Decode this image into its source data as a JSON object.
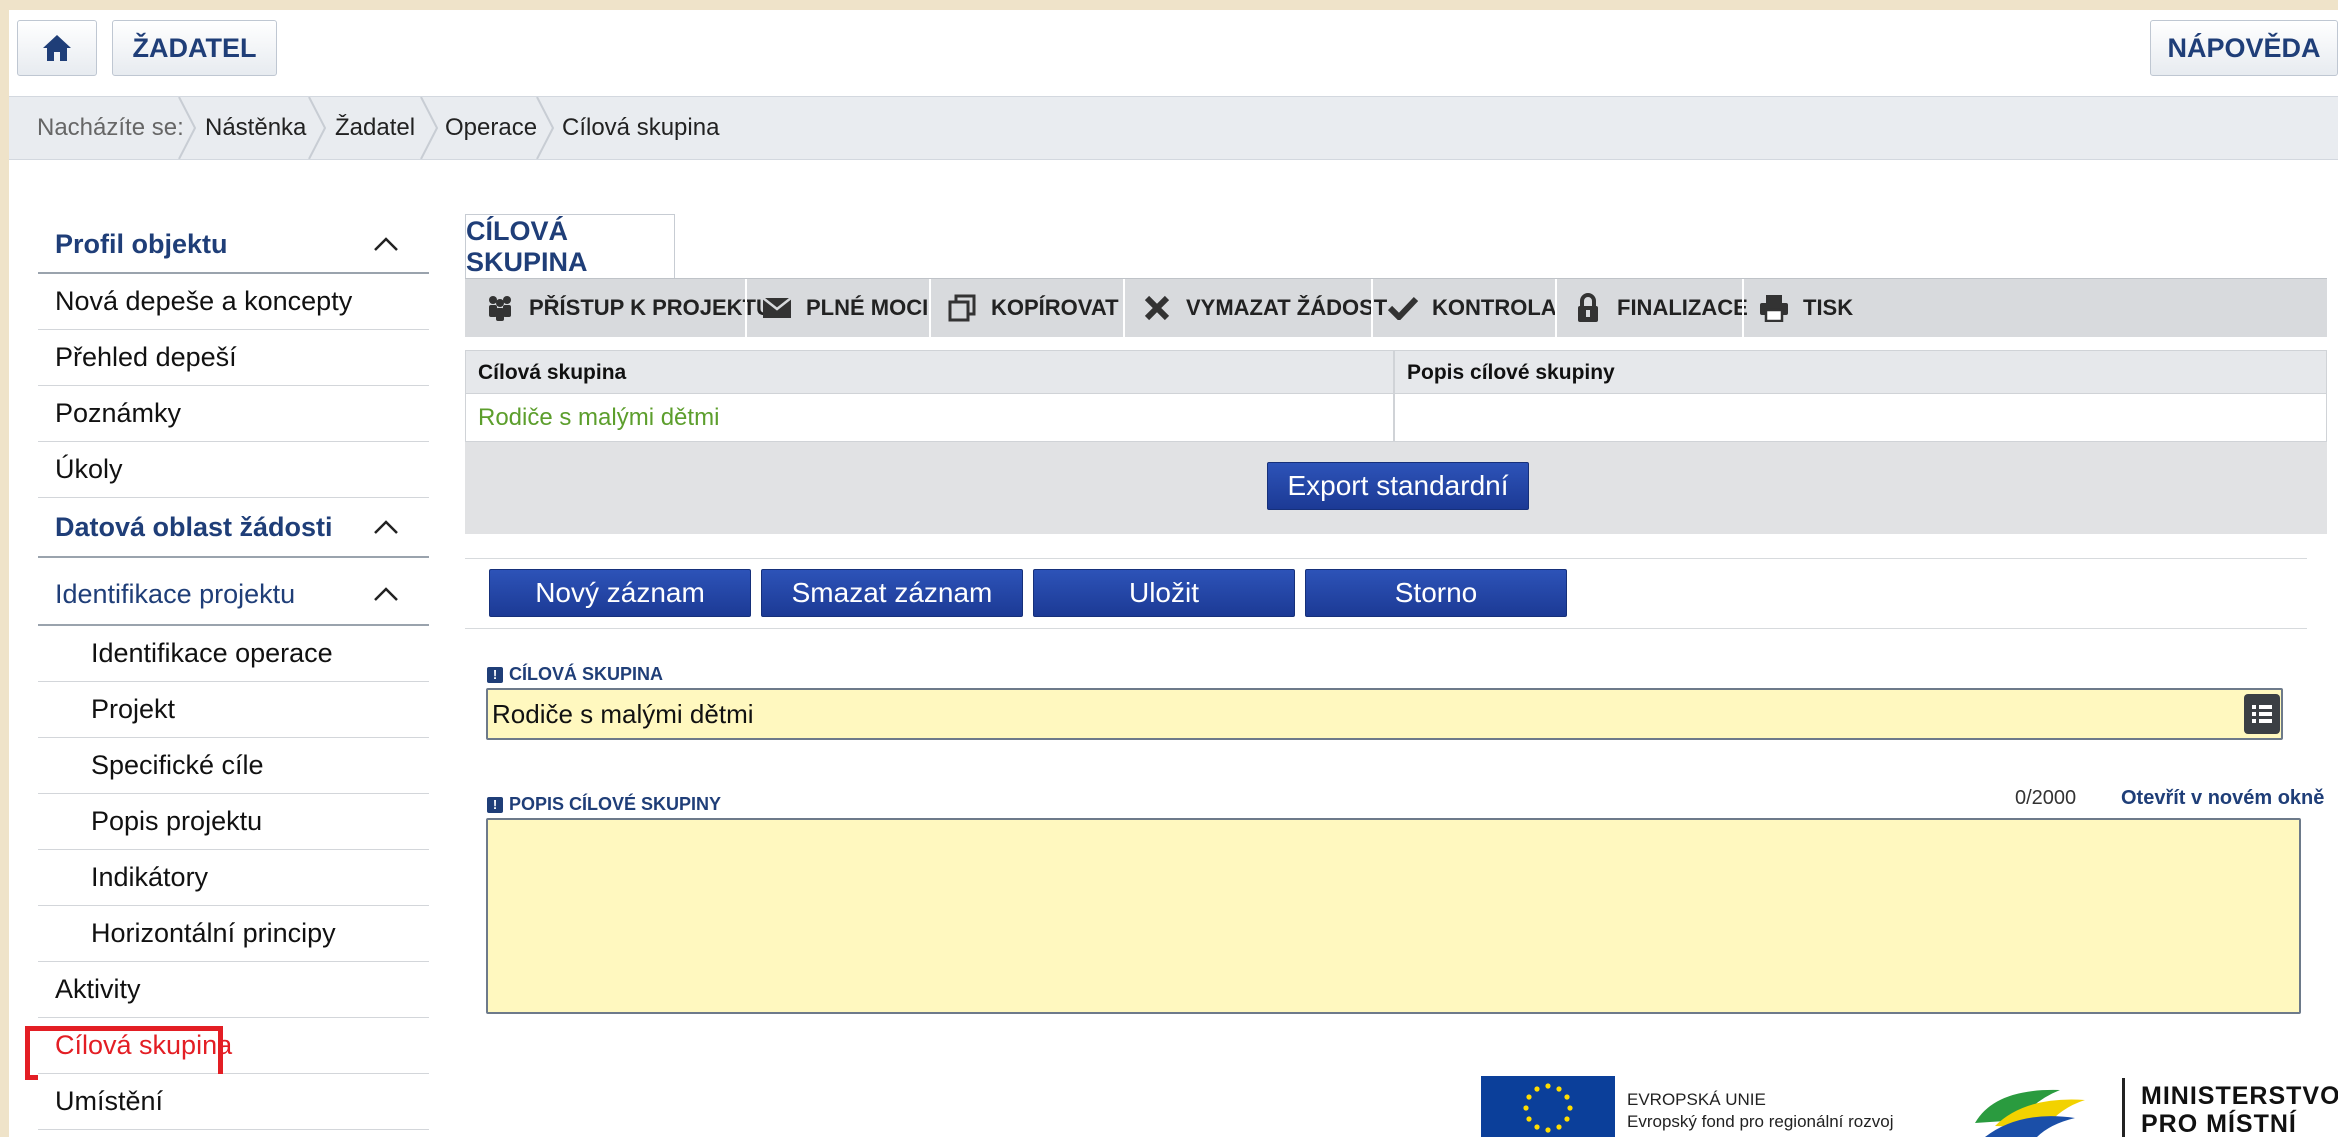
{
  "topbar": {
    "home_icon": "home-icon",
    "applicant_label": "ŽADATEL",
    "help_label": "NÁPOVĚDA"
  },
  "breadcrumb": {
    "prefix": "Nacházíte se:",
    "items": [
      "Nástěnka",
      "Žadatel",
      "Operace",
      "Cílová skupina"
    ]
  },
  "sidebar": {
    "items": [
      {
        "label": "Profil objektu",
        "type": "head"
      },
      {
        "label": "Nová depeše a koncepty",
        "type": "item"
      },
      {
        "label": "Přehled depeší",
        "type": "item"
      },
      {
        "label": "Poznámky",
        "type": "item"
      },
      {
        "label": "Úkoly",
        "type": "item"
      },
      {
        "label": "Datová oblast žádosti",
        "type": "head"
      },
      {
        "label": "Identifikace projektu",
        "type": "subhead"
      },
      {
        "label": "Identifikace operace",
        "type": "sub"
      },
      {
        "label": "Projekt",
        "type": "sub"
      },
      {
        "label": "Specifické cíle",
        "type": "sub"
      },
      {
        "label": "Popis projektu",
        "type": "sub"
      },
      {
        "label": "Indikátory",
        "type": "sub"
      },
      {
        "label": "Horizontální principy",
        "type": "sub"
      },
      {
        "label": "Aktivity",
        "type": "item"
      },
      {
        "label": "Cílová skupina",
        "type": "active"
      },
      {
        "label": "Umístění",
        "type": "item"
      }
    ]
  },
  "main": {
    "tab_label": "CÍLOVÁ SKUPINA",
    "toolbar": [
      {
        "label": "PŘÍSTUP K PROJEKTU",
        "icon": "people-icon"
      },
      {
        "label": "PLNÉ MOCI",
        "icon": "envelope-icon"
      },
      {
        "label": "KOPÍROVAT",
        "icon": "copy-icon"
      },
      {
        "label": "VYMAZAT ŽÁDOST",
        "icon": "delete-icon"
      },
      {
        "label": "KONTROLA",
        "icon": "check-icon"
      },
      {
        "label": "FINALIZACE",
        "icon": "lock-icon"
      },
      {
        "label": "TISK",
        "icon": "print-icon"
      }
    ],
    "grid": {
      "headers": [
        "Cílová skupina",
        "Popis cílové skupiny"
      ],
      "rows": [
        [
          "Rodiče s malými dětmi",
          ""
        ]
      ]
    },
    "export_label": "Export standardní",
    "actions": {
      "new": "Nový záznam",
      "delete": "Smazat záznam",
      "save": "Uložit",
      "cancel": "Storno"
    },
    "form": {
      "group_label": "CÍLOVÁ SKUPINA",
      "group_value": "Rodiče s malými dětmi",
      "desc_label": "POPIS CÍLOVÉ SKUPINY",
      "desc_value": "",
      "counter": "0/2000",
      "open_new_window": "Otevřít v novém okně",
      "required_mark": "!"
    }
  },
  "footer": {
    "eu_line1": "EVROPSKÁ UNIE",
    "eu_line2": "Evropský fond pro regionální rozvoj",
    "ministry_line1": "MINISTERSTVO",
    "ministry_line2": "PRO MÍSTNÍ"
  },
  "colors": {
    "brand_blue": "#1f3e78",
    "button_blue": "#1c3a95",
    "field_yellow": "#fff8bf",
    "active_red": "#e31e24",
    "value_green": "#5c9e2c"
  }
}
